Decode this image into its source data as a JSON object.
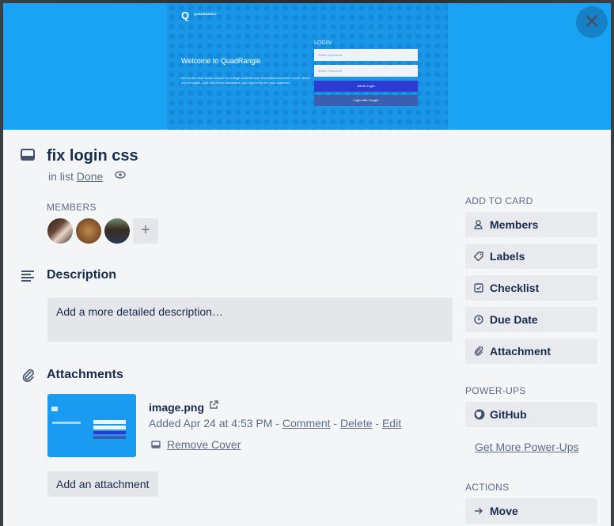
{
  "card": {
    "title": "fix login css",
    "in_list_prefix": "in list",
    "list_name": "Done"
  },
  "cover": {
    "brand": "Q",
    "brand_name": "QUADRANGLE",
    "welcome": "Welcome to QuadRangle",
    "blurb": "We are the best social network for college students and universities around the world. Share your thoughts, chat with fellow classmates, and log events into your calendar!",
    "login_label": "LOGIN",
    "username_placeholder": "Admin Username",
    "password_placeholder": "Admin Password",
    "admin_login": "Admin Login",
    "google_login": "Login with Google"
  },
  "members": {
    "label": "MEMBERS",
    "add": "+"
  },
  "description": {
    "heading": "Description",
    "placeholder": "Add a more detailed description…"
  },
  "attachments": {
    "heading": "Attachments",
    "file_name": "image.png",
    "added_text": "Added Apr 24 at 4:53 PM -",
    "comment": "Comment",
    "delete": "Delete",
    "edit": "Edit",
    "sep": "-",
    "remove_cover": "Remove Cover",
    "add_button": "Add an attachment"
  },
  "sidebar": {
    "add_to_card_label": "ADD TO CARD",
    "members": "Members",
    "labels": "Labels",
    "checklist": "Checklist",
    "due_date": "Due Date",
    "attachment": "Attachment",
    "powerups_label": "POWER-UPS",
    "github": "GitHub",
    "get_more": "Get More Power-Ups",
    "actions_label": "ACTIONS",
    "move": "Move"
  },
  "close_glyph": "✕",
  "colors": {
    "cover_blue": "#1aa3f3",
    "modal_bg": "#f4f5f7",
    "button_bg": "#e8eaee"
  }
}
